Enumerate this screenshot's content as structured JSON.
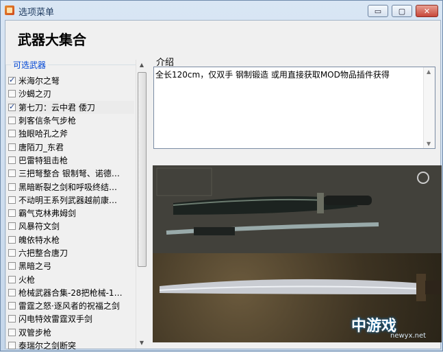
{
  "window": {
    "title": "选项菜单"
  },
  "titlebar_buttons": {
    "min": "▭",
    "max": "▢",
    "close": "✕"
  },
  "main_title": "武器大集合",
  "group": {
    "legend": "可选武器"
  },
  "weapons": [
    {
      "label": "米海尔之弩",
      "checked": true
    },
    {
      "label": "沙蝎之刃",
      "checked": false
    },
    {
      "label": "第七刀：云中君 倭刀",
      "checked": true,
      "selected": true
    },
    {
      "label": "刺客信条气步枪",
      "checked": false
    },
    {
      "label": "独眼哈孔之斧",
      "checked": false
    },
    {
      "label": "唐陌刀_东君",
      "checked": false
    },
    {
      "label": "巴雷特狙击枪",
      "checked": false
    },
    {
      "label": "三把弩整合 银制弩、诺德…",
      "checked": false
    },
    {
      "label": "黑暗断裂之剑和呼吸终结…",
      "checked": false
    },
    {
      "label": "不动明王系列武器越前康…",
      "checked": false
    },
    {
      "label": "霸气克林弗姆剑",
      "checked": false
    },
    {
      "label": "风暴符文剑",
      "checked": false
    },
    {
      "label": "魄依特水枪",
      "checked": false
    },
    {
      "label": "六把整合唐刀",
      "checked": false
    },
    {
      "label": "黑暗之弓",
      "checked": false
    },
    {
      "label": "火枪",
      "checked": false
    },
    {
      "label": "枪械武器合集-28把枪械-1…",
      "checked": false
    },
    {
      "label": "雷霆之怒·逐风者的祝福之剑",
      "checked": false
    },
    {
      "label": "闪电特效雷霆双手剑",
      "checked": false
    },
    {
      "label": "双管步枪",
      "checked": false
    },
    {
      "label": "泰瑞尔之剑断突",
      "checked": false
    }
  ],
  "intro": {
    "label": "介绍",
    "text": "全长120cm，仅双手 钢制锻造 或用直接获取MOD物品插件获得"
  },
  "watermark": {
    "brand": "中游戏",
    "url": "newyx.net"
  }
}
